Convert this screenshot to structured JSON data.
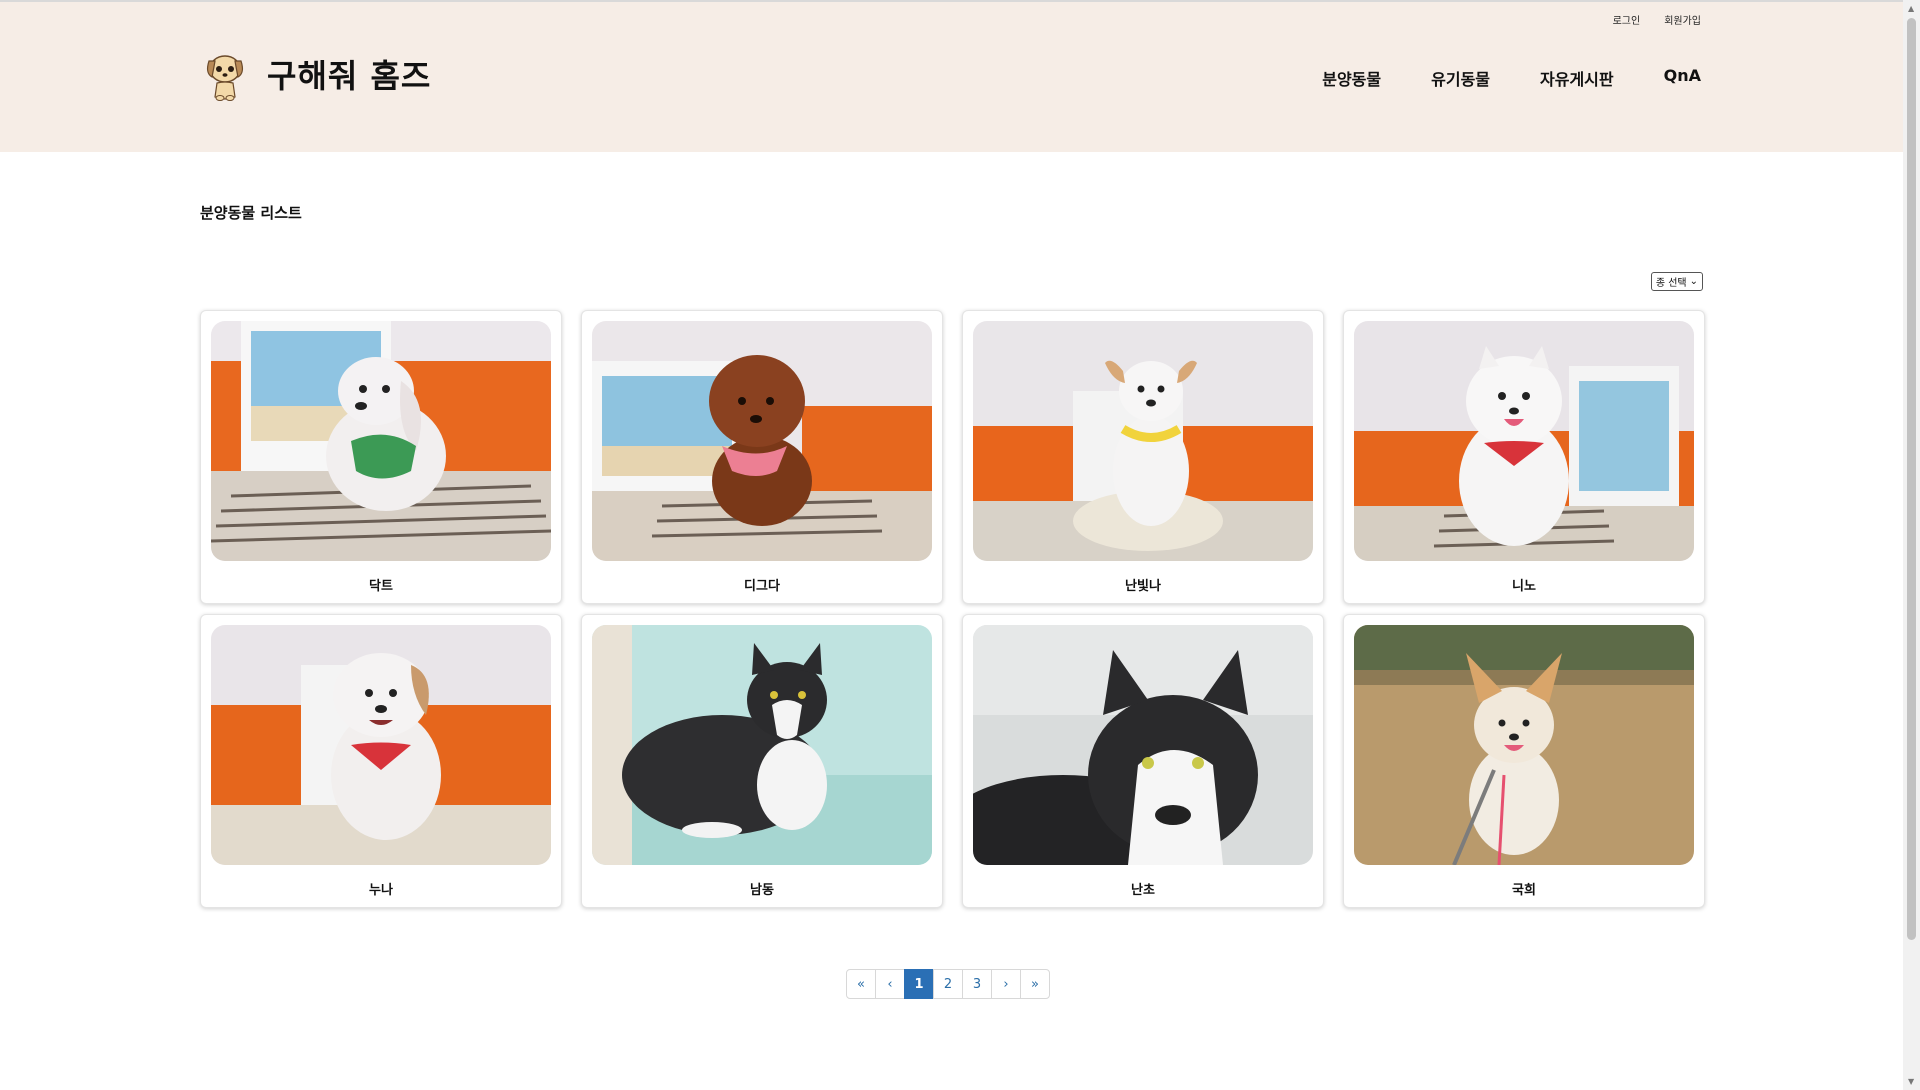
{
  "header": {
    "logo_text": "구해줘 홈즈",
    "util_links": [
      "로그인",
      "회원가입"
    ],
    "nav": [
      "분양동물",
      "유기동물",
      "자유게시판",
      "QnA"
    ],
    "background": "#f6ede6"
  },
  "main": {
    "title": "분양동물 리스트",
    "filter": {
      "selected": "종 선택"
    }
  },
  "cards": [
    {
      "name": "닥트"
    },
    {
      "name": "디그다"
    },
    {
      "name": "난빛나"
    },
    {
      "name": "니노"
    },
    {
      "name": "누나"
    },
    {
      "name": "남동"
    },
    {
      "name": "난초"
    },
    {
      "name": "국희"
    }
  ],
  "pagination": {
    "first": "«",
    "prev": "‹",
    "pages": [
      "1",
      "2",
      "3"
    ],
    "current": "1",
    "next": "›",
    "last": "»",
    "active_color": "#2a6fb5"
  }
}
